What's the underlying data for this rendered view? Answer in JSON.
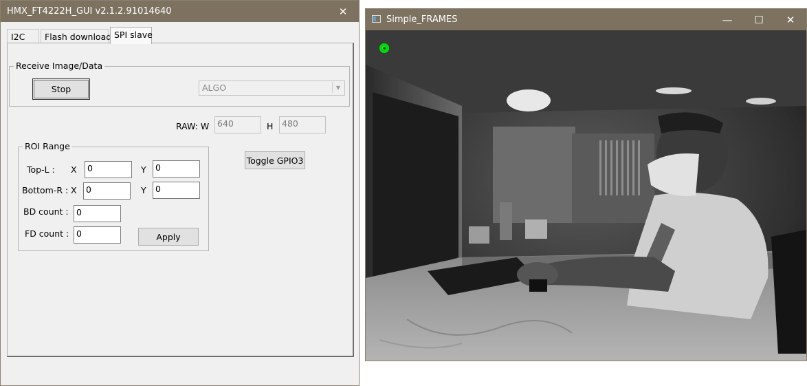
{
  "left_window": {
    "title": "HMX_FT4222H_GUI v2.1.2.91014640",
    "close_glyph": "✕",
    "tabs": [
      {
        "label": "I2C"
      },
      {
        "label": "Flash download"
      },
      {
        "label": "SPI slave"
      }
    ],
    "receive_group": {
      "label": "Receive Image/Data",
      "stop_button": "Stop",
      "mode_select": {
        "value": "ALGO"
      }
    },
    "raw": {
      "w_label": "RAW: W",
      "w_value": "640",
      "h_label": "H",
      "h_value": "480"
    },
    "roi_group": {
      "label": "ROI Range",
      "top_l_label": "Top-L :",
      "bottom_r_label": "Bottom-R :",
      "x_label": "X",
      "y_label": "Y",
      "top_x": "0",
      "top_y": "0",
      "bottom_x": "0",
      "bottom_y": "0",
      "bd_label": "BD count :",
      "bd_value": "0",
      "fd_label": "FD count :",
      "fd_value": "0",
      "apply_button": "Apply"
    },
    "toggle_button": "Toggle GPIO3"
  },
  "right_window": {
    "title": "Simple_FRAMES",
    "minimize_glyph": "—",
    "maximize_glyph": "☐",
    "close_glyph": "✕",
    "marker_color": "#00e000"
  }
}
